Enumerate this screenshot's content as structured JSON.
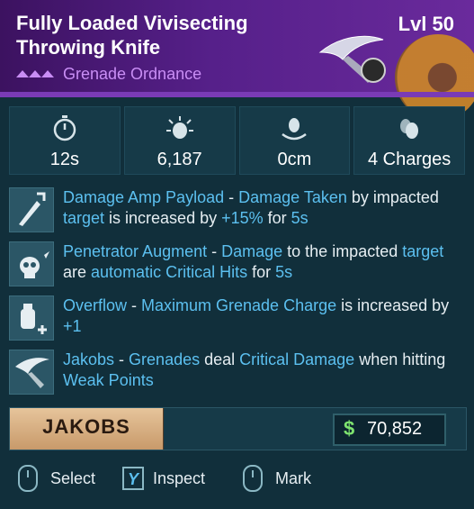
{
  "item": {
    "name": "Fully Loaded Vivisecting Throwing Knife",
    "level": "Lvl 50",
    "rarity_label": "Grenade Ordnance"
  },
  "stats": [
    {
      "icon": "stopwatch-icon",
      "value": "12s"
    },
    {
      "icon": "damage-grenade-icon",
      "value": "6,187"
    },
    {
      "icon": "radius-grenade-icon",
      "value": "0cm"
    },
    {
      "icon": "grenade-charges-icon",
      "value": "4 Charges"
    }
  ],
  "perks": [
    {
      "icon": "knife-amp-icon",
      "segments": [
        {
          "t": "Damage Amp Payload",
          "h": true
        },
        {
          "t": " - ",
          "h": false
        },
        {
          "t": "Damage Taken",
          "h": true
        },
        {
          "t": " by impacted ",
          "h": false
        },
        {
          "t": "target",
          "h": true
        },
        {
          "t": " is increased by ",
          "h": false
        },
        {
          "t": "+15%",
          "h": true
        },
        {
          "t": " for ",
          "h": false
        },
        {
          "t": "5s",
          "h": true
        }
      ]
    },
    {
      "icon": "skull-impact-icon",
      "segments": [
        {
          "t": "Penetrator Augment",
          "h": true
        },
        {
          "t": " - ",
          "h": false
        },
        {
          "t": "Damage",
          "h": true
        },
        {
          "t": " to the impacted ",
          "h": false
        },
        {
          "t": "target",
          "h": true
        },
        {
          "t": " are ",
          "h": false
        },
        {
          "t": "automatic Critical Hits",
          "h": true
        },
        {
          "t": " for ",
          "h": false
        },
        {
          "t": "5s",
          "h": true
        }
      ]
    },
    {
      "icon": "grenade-plus-icon",
      "segments": [
        {
          "t": "Overflow",
          "h": true
        },
        {
          "t": " - ",
          "h": false
        },
        {
          "t": "Maximum Grenade Charge",
          "h": true
        },
        {
          "t": " is increased by ",
          "h": false
        },
        {
          "t": "+1",
          "h": true
        }
      ]
    },
    {
      "icon": "throwing-knife-icon",
      "segments": [
        {
          "t": "Jakobs",
          "h": true
        },
        {
          "t": " - ",
          "h": false
        },
        {
          "t": "Grenades",
          "h": true
        },
        {
          "t": " deal ",
          "h": false
        },
        {
          "t": "Critical Damage",
          "h": true
        },
        {
          "t": " when hitting ",
          "h": false
        },
        {
          "t": "Weak Points",
          "h": true
        }
      ]
    }
  ],
  "manufacturer": {
    "name": "JAKOBS"
  },
  "price": {
    "currency_symbol": "$",
    "amount": "70,852"
  },
  "controls": [
    {
      "key_icon": "mouse-left-icon",
      "label": "Select"
    },
    {
      "key_label": "Y",
      "label": "Inspect"
    },
    {
      "key_icon": "mouse-right-icon",
      "label": "Mark"
    }
  ],
  "colors": {
    "highlight": "#5cc0f0",
    "rarity": "#c98ef5",
    "header": "#56208a",
    "price": "#7ee36f"
  }
}
